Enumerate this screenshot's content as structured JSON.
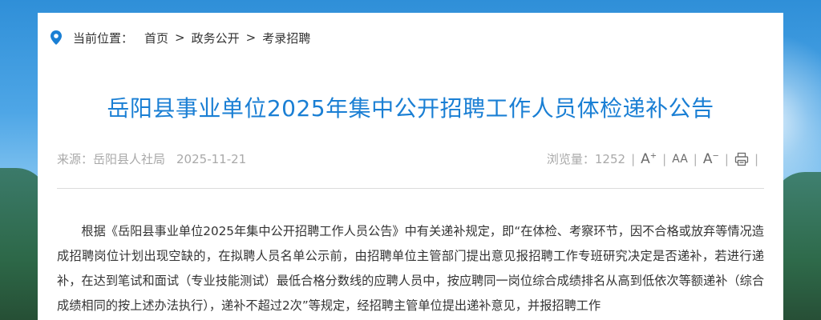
{
  "breadcrumb": {
    "label": "当前位置：",
    "items": [
      "首页",
      "政务公开",
      "考录招聘"
    ],
    "separator": ">"
  },
  "article": {
    "title": "岳阳县事业单位2025年集中公开招聘工作人员体检递补公告",
    "source": "来源：岳阳县人社局",
    "date": "2025-11-21",
    "views_label": "浏览量：",
    "views": "1252",
    "body": "根据《岳阳县事业单位2025年集中公开招聘工作人员公告》中有关递补规定，即“在体检、考察环节，因不合格或放弃等情况造成招聘岗位计划出现空缺的，在拟聘人员名单公示前，由招聘单位主管部门提出意见报招聘工作专班研究决定是否递补，若进行递补，在达到笔试和面试（专业技能测试）最低合格分数线的应聘人员中，按应聘同一岗位综合成绩排名从高到低依次等额递补（综合成绩相同的按上述办法执行），递补不超过2次”等规定，经招聘主管单位提出递补意见，并报招聘工作"
  },
  "tools": {
    "font_increase": "A",
    "font_reset": "AA",
    "font_decrease": "A",
    "print_icon": "printer-icon"
  },
  "colors": {
    "title": "#1a7fd4",
    "pin": "#1a7fd4",
    "meta": "#a9a9a9"
  }
}
